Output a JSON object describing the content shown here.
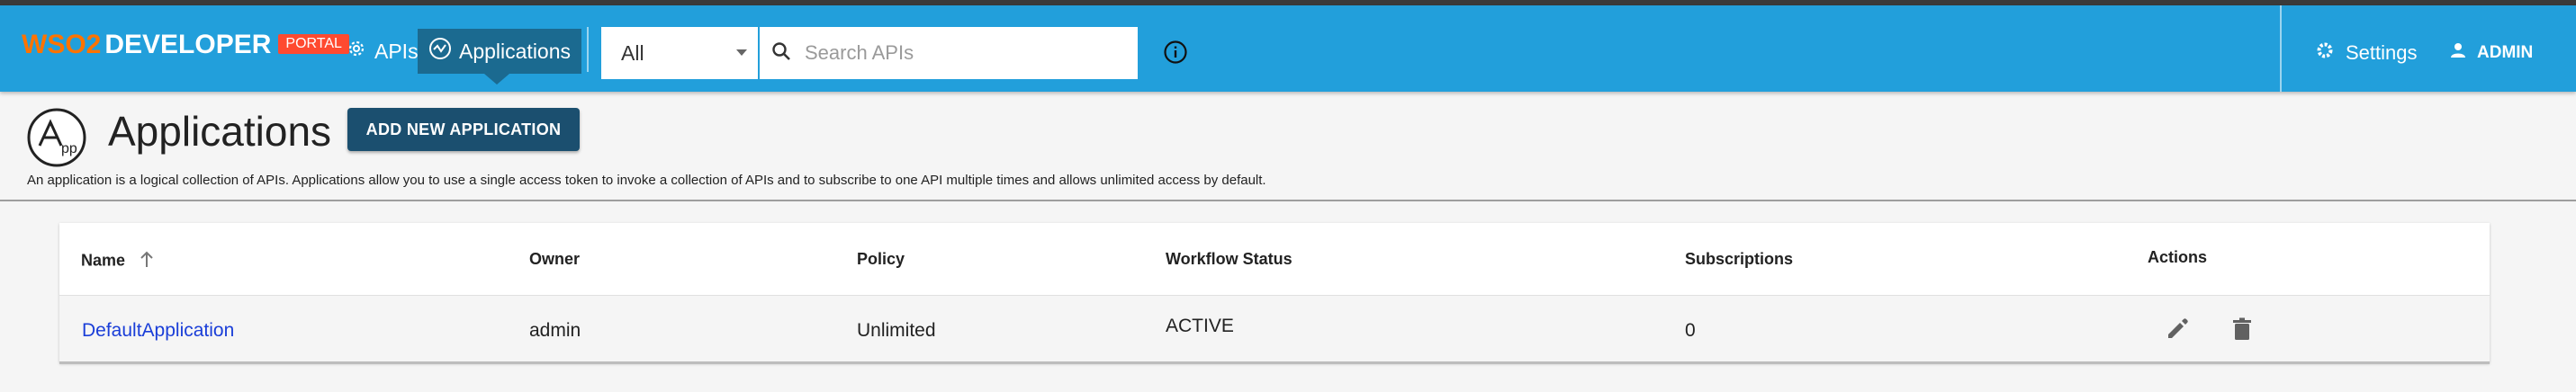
{
  "header": {
    "logo": {
      "prefix": "WSO2",
      "brand": "DEVELOPER",
      "badge": "PORTAL"
    },
    "nav": [
      {
        "label": "APIs",
        "icon": "gear-icon"
      },
      {
        "label": "Applications",
        "icon": "activity-icon",
        "active": true
      }
    ],
    "search": {
      "scope_value": "All",
      "placeholder": "Search APIs"
    },
    "settings_label": "Settings",
    "user_label": "ADMIN"
  },
  "page": {
    "title": "Applications",
    "add_button": "ADD NEW APPLICATION",
    "description": "An application is a logical collection of APIs. Applications allow you to use a single access token to invoke a collection of APIs and to subscribe to one API multiple times and allows unlimited access by default."
  },
  "table": {
    "columns": [
      "Name",
      "Owner",
      "Policy",
      "Workflow Status",
      "Subscriptions",
      "Actions"
    ],
    "rows": [
      {
        "name": "DefaultApplication",
        "owner": "admin",
        "policy": "Unlimited",
        "status": "ACTIVE",
        "subscriptions": "0"
      }
    ]
  },
  "colors": {
    "appbar": "#229fdb",
    "active_nav": "#1b6a90",
    "button": "#1b4f6f",
    "link": "#1a3ed8"
  }
}
